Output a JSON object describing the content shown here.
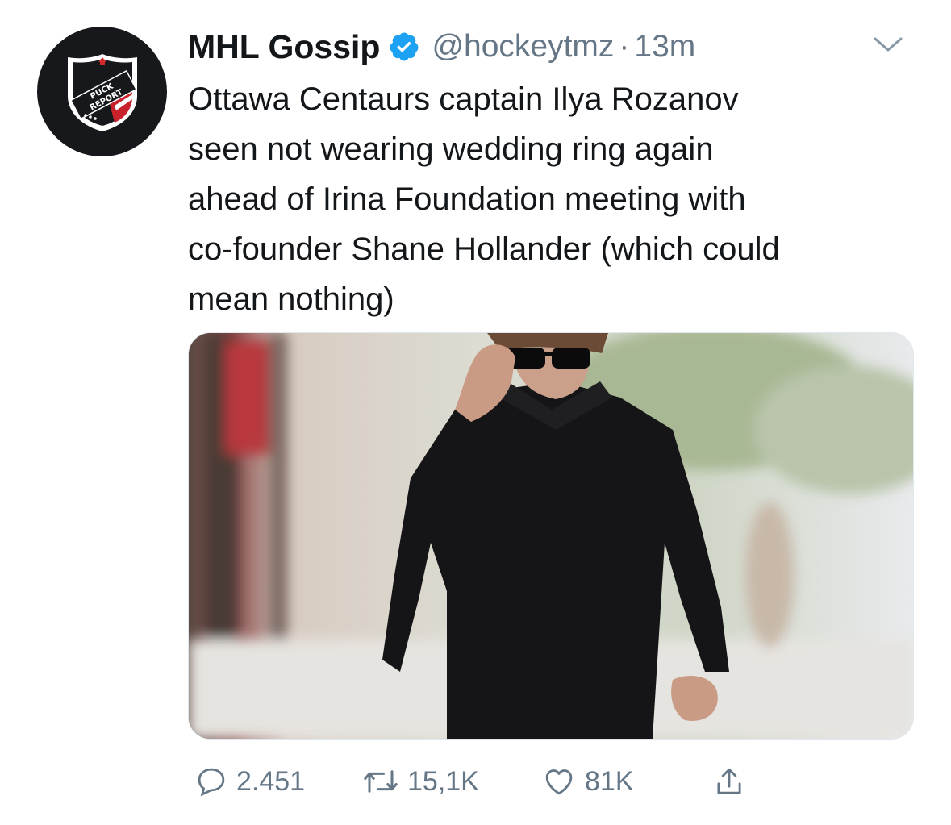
{
  "tweet": {
    "author_name": "MHL Gossip",
    "handle": "@hockeytmz",
    "separator": "·",
    "time": "13m",
    "text": "Ottawa Centaurs captain Ilya Rozanov\nseen not wearing wedding ring again\nahead of Irina Foundation meeting with\nco-founder Shane Hollander (which could\nmean nothing)",
    "avatar": {
      "logo_text_top": "PUCK",
      "logo_text_bottom": "REPORT",
      "icon": "puck-report-shield-logo"
    },
    "verified_icon": "verified-badge-icon",
    "menu_icon": "chevron-down-icon"
  },
  "actions": {
    "replies": "2.451",
    "retweets": "15,1K",
    "likes": "81K",
    "reply_icon": "reply-icon",
    "retweet_icon": "retweet-icon",
    "like_icon": "heart-icon",
    "share_icon": "share-icon"
  },
  "colors": {
    "text": "#14171a",
    "secondary": "#657786",
    "verified": "#1da1f2",
    "avatar_bg": "#16181b"
  }
}
